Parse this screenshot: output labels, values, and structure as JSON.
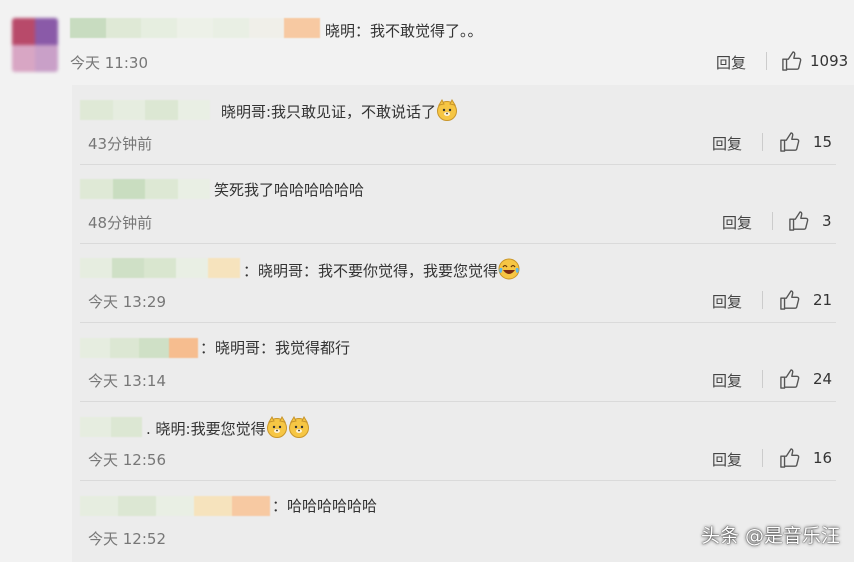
{
  "main_comment": {
    "text": "晓明：我不敢觉得了。。",
    "time": "今天 11:30",
    "reply_label": "回复",
    "likes": "1093"
  },
  "replies": [
    {
      "text": "晓明哥:我只敢见证，不敢说话了",
      "time": "43分钟前",
      "reply_label": "回复",
      "likes": "15",
      "emoji": "doge-icon"
    },
    {
      "text": "笑死我了哈哈哈哈哈哈",
      "time": "48分钟前",
      "reply_label": "回复",
      "likes": "3"
    },
    {
      "text": "：晓明哥：我不要你觉得，我要您觉得",
      "time": "今天 13:29",
      "reply_label": "回复",
      "likes": "21",
      "emoji": "laugh-cry-icon"
    },
    {
      "text": "：晓明哥：我觉得都行",
      "time": "今天 13:14",
      "reply_label": "回复",
      "likes": "24"
    },
    {
      "text": ". 晓明:我要您觉得",
      "time": "今天 12:56",
      "reply_label": "回复",
      "likes": "16",
      "emoji": "doge-icon"
    },
    {
      "text": "：哈哈哈哈哈哈",
      "time": "今天 12:52",
      "reply_label": "回复",
      "likes": ""
    }
  ],
  "watermark": "头条 @是音乐汪",
  "colors": {
    "background": "#f2f2f2",
    "panel": "#ececec",
    "emoji_yellow": "#f6c644"
  }
}
